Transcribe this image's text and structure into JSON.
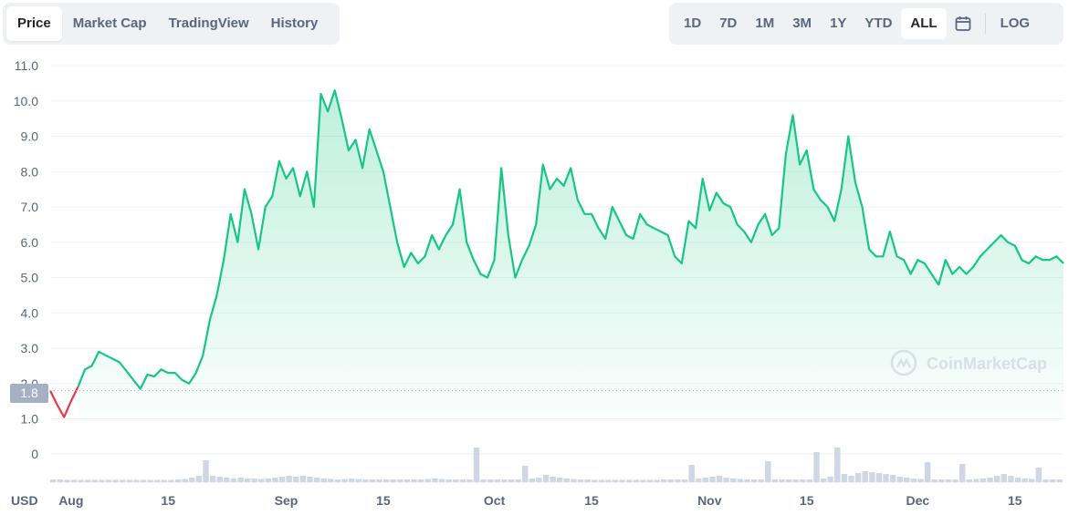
{
  "tabs": [
    {
      "label": "Price",
      "active": true
    },
    {
      "label": "Market Cap",
      "active": false
    },
    {
      "label": "TradingView",
      "active": false
    },
    {
      "label": "History",
      "active": false
    }
  ],
  "ranges": [
    {
      "label": "1D",
      "active": false
    },
    {
      "label": "7D",
      "active": false
    },
    {
      "label": "1M",
      "active": false
    },
    {
      "label": "3M",
      "active": false
    },
    {
      "label": "1Y",
      "active": false
    },
    {
      "label": "YTD",
      "active": false
    },
    {
      "label": "ALL",
      "active": true
    }
  ],
  "calendar_icon": "calendar-icon",
  "log_label": "LOG",
  "watermark": "CoinMarketCap",
  "currency_label": "USD",
  "colors": {
    "up": "#16c784",
    "down": "#ea3943",
    "volume": "#cfd6e4",
    "grid": "#eff2f5",
    "badge": "#a6b0c3"
  },
  "chart_data": {
    "type": "area",
    "current_price_label": "1.8",
    "y_ticks": [
      "11.0",
      "10.0",
      "9.0",
      "8.0",
      "7.0",
      "6.0",
      "5.0",
      "4.0",
      "3.0",
      "2.0",
      "1.0"
    ],
    "volume_tick": "0",
    "ylim": [
      1.0,
      11.0
    ],
    "x_tick_labels": [
      "Aug",
      "15",
      "Sep",
      "15",
      "Oct",
      "15",
      "Nov",
      "15",
      "Dec",
      "15"
    ],
    "x_tick_positions": [
      3,
      17,
      34,
      48,
      64,
      78,
      95,
      109,
      125,
      139
    ],
    "series": [
      {
        "values": [
          1.8,
          1.4,
          1.05,
          1.5,
          1.9
        ]
      },
      {
        "values": [
          1.9,
          2.4,
          2.5,
          2.9,
          2.8,
          2.7,
          2.6,
          2.35,
          2.1,
          1.85,
          2.25,
          2.2,
          2.4,
          2.3,
          2.3,
          2.1,
          2.0,
          2.3,
          2.8,
          3.8,
          4.5,
          5.5,
          6.8,
          6.0,
          7.5,
          6.8,
          5.8,
          7.0,
          7.3,
          8.3,
          7.8,
          8.1,
          7.3,
          8.0,
          7.0,
          10.2,
          9.7,
          10.3,
          9.5,
          8.6,
          8.9,
          8.1,
          9.2,
          8.6,
          8.0,
          7.0,
          6.0,
          5.3,
          5.7,
          5.4,
          5.6,
          6.2,
          5.8,
          6.2,
          6.5,
          7.5,
          6.0,
          5.5,
          5.1,
          5.0,
          5.5,
          8.1,
          6.2,
          5.0,
          5.5,
          5.9,
          6.5,
          8.2,
          7.5,
          7.8,
          7.6,
          8.1,
          7.2,
          6.8,
          6.8,
          6.4,
          6.1,
          7.0,
          6.6,
          6.2,
          6.1,
          6.8,
          6.5,
          6.4,
          6.3,
          6.2,
          5.6,
          5.4,
          6.6,
          6.4,
          7.8,
          6.9,
          7.4,
          7.1,
          7.0,
          6.5,
          6.3,
          6.0,
          6.5,
          6.8,
          6.2,
          6.4,
          8.5,
          9.6,
          8.2,
          8.6,
          7.5,
          7.2,
          7.0,
          6.6,
          7.5,
          9.0,
          7.7,
          7.0,
          5.8,
          5.6,
          5.6,
          6.3,
          5.6,
          5.5,
          5.1,
          5.5,
          5.4,
          5.1,
          4.8,
          5.5,
          5.1,
          5.3,
          5.1,
          5.3,
          5.6,
          5.8,
          6.0,
          6.2,
          6.0,
          5.9,
          5.5,
          5.4,
          5.6,
          5.5,
          5.5,
          5.6,
          5.4
        ]
      }
    ],
    "volume": [
      3,
      3,
      2.5,
      2.5,
      2.5,
      2.5,
      2.5,
      2.5,
      2.5,
      2.5,
      2.5,
      2.5,
      2.5,
      2.5,
      2.5,
      2.5,
      2.5,
      2.5,
      3,
      3.5,
      5,
      7,
      10,
      7,
      6,
      5,
      4,
      5,
      4,
      4,
      3.5,
      4,
      5,
      6,
      7,
      6,
      7,
      6,
      5,
      4,
      3.5,
      3,
      3.5,
      4,
      3.5,
      3,
      3,
      3,
      3,
      3,
      3,
      3,
      3,
      3,
      3.5,
      4,
      3.5,
      3,
      3,
      3,
      3,
      3,
      3,
      3,
      3,
      3,
      3,
      3,
      3.5,
      4,
      5,
      8,
      6,
      5,
      4,
      3.5,
      3,
      3,
      2.5,
      2.5,
      2.5,
      2.5,
      2.5,
      2.5,
      2.5,
      2.5,
      2.5,
      2.5,
      3,
      3,
      3,
      3,
      3.5,
      4,
      5,
      6,
      7,
      5,
      4,
      3.5,
      3,
      3,
      3,
      3,
      3,
      3,
      3,
      3,
      3,
      3,
      3.5,
      4,
      6,
      10,
      9,
      7,
      10,
      12,
      11,
      10,
      9,
      8,
      6,
      5,
      4,
      3.5,
      3,
      3,
      3,
      3,
      3,
      3,
      3,
      3.5,
      4,
      5,
      7,
      9,
      7,
      5,
      4,
      3.5,
      3,
      3,
      3,
      3
    ],
    "volume_peaks": [
      [
        22,
        24
      ],
      [
        61,
        38
      ],
      [
        68,
        18
      ],
      [
        92,
        19
      ],
      [
        103,
        23
      ],
      [
        110,
        33
      ],
      [
        113,
        38
      ],
      [
        126,
        22
      ],
      [
        131,
        20
      ],
      [
        142,
        16
      ]
    ]
  }
}
